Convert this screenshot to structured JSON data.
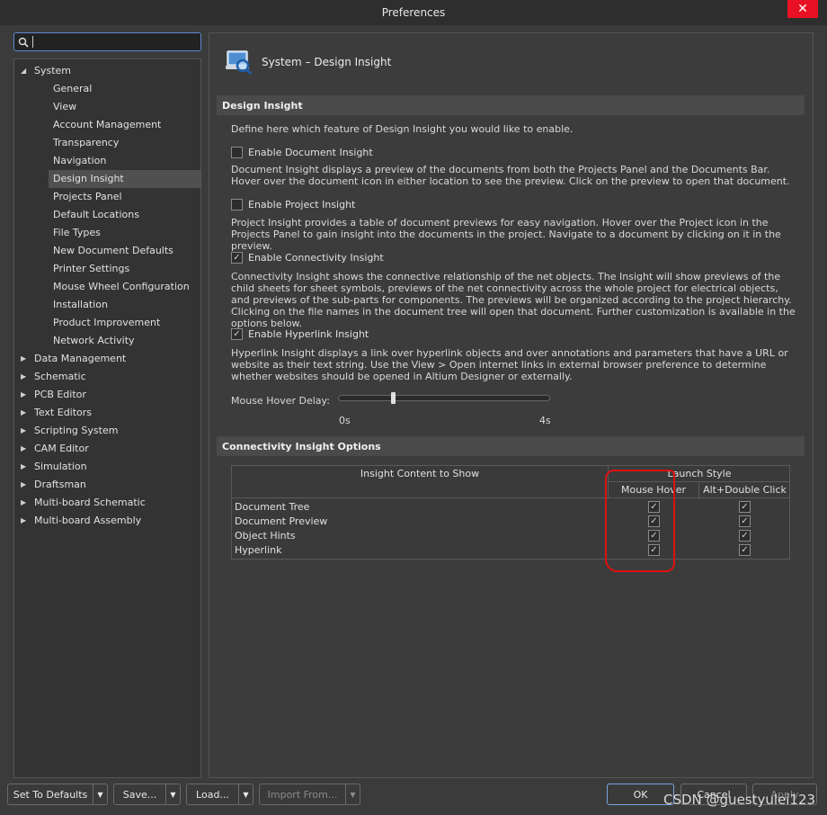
{
  "window": {
    "title": "Preferences",
    "close_glyph": "✕"
  },
  "search": {
    "value": "",
    "placeholder": ""
  },
  "tree": {
    "system_label": "System",
    "system_children": [
      "General",
      "View",
      "Account Management",
      "Transparency",
      "Navigation",
      "Design Insight",
      "Projects Panel",
      "Default Locations",
      "File Types",
      "New Document Defaults",
      "Printer Settings",
      "Mouse Wheel Configuration",
      "Installation",
      "Product Improvement",
      "Network Activity"
    ],
    "selected": "Design Insight",
    "top_items": [
      "Data Management",
      "Schematic",
      "PCB Editor",
      "Text Editors",
      "Scripting System",
      "CAM Editor",
      "Simulation",
      "Draftsman",
      "Multi-board Schematic",
      "Multi-board Assembly"
    ]
  },
  "panel": {
    "header_title": "System – Design Insight",
    "section1_title": "Design Insight",
    "intro": "Define here which feature of Design Insight you would like to enable.",
    "doc_insight": {
      "label": "Enable Document Insight",
      "checked": false,
      "desc": "Document Insight displays a preview of the documents from both the Projects Panel and the Documents Bar. Hover over the document icon in either location to see the preview. Click on the preview to open that document."
    },
    "project_insight": {
      "label": "Enable Project Insight",
      "checked": false,
      "desc": "Project Insight provides a table of document previews for easy navigation. Hover over the Project icon in the Projects Panel to gain insight into the documents in the project. Navigate to a document by clicking on it in the preview."
    },
    "connectivity_insight": {
      "label": "Enable Connectivity Insight",
      "checked": true,
      "desc": "Connectivity Insight shows the connective relationship of the net objects. The Insight will show previews of the child sheets for sheet symbols, previews of the net connectivity across the whole project for electrical objects, and previews of the sub-parts for components. The previews will be organized according to the project hierarchy. Clicking on the file names in the document tree will open that document. Further customization is available in the options below."
    },
    "hyperlink_insight": {
      "label": "Enable Hyperlink Insight",
      "checked": true,
      "desc": "Hyperlink Insight displays a link over hyperlink objects and over annotations and parameters that have a URL or website as their text string. Use the View > Open internet links in external browser preference to determine whether websites should be opened in Altium Designer or externally."
    },
    "hover_delay": {
      "label": "Mouse Hover Delay:",
      "min_label": "0s",
      "max_label": "4s",
      "value_fraction": 0.26
    },
    "section2_title": "Connectivity Insight Options",
    "table": {
      "col_content": "Insight Content to Show",
      "col_launch": "Launch Style",
      "col_hover": "Mouse Hover",
      "col_alt": "Alt+Double Click",
      "rows": [
        {
          "label": "Document Tree",
          "hover": true,
          "alt": true
        },
        {
          "label": "Document Preview",
          "hover": true,
          "alt": true
        },
        {
          "label": "Object Hints",
          "hover": true,
          "alt": true
        },
        {
          "label": "Hyperlink",
          "hover": true,
          "alt": true
        }
      ]
    }
  },
  "buttons": {
    "set_defaults": "Set To Defaults",
    "save": "Save...",
    "load": "Load...",
    "import_from": "Import From...",
    "ok": "OK",
    "cancel": "Cancel",
    "apply": "Apply"
  },
  "watermark": "CSDN @guestyulei123",
  "colors": {
    "accent": "#5e8ad0",
    "annotation_red": "#d11111",
    "close_red": "#e81123"
  }
}
